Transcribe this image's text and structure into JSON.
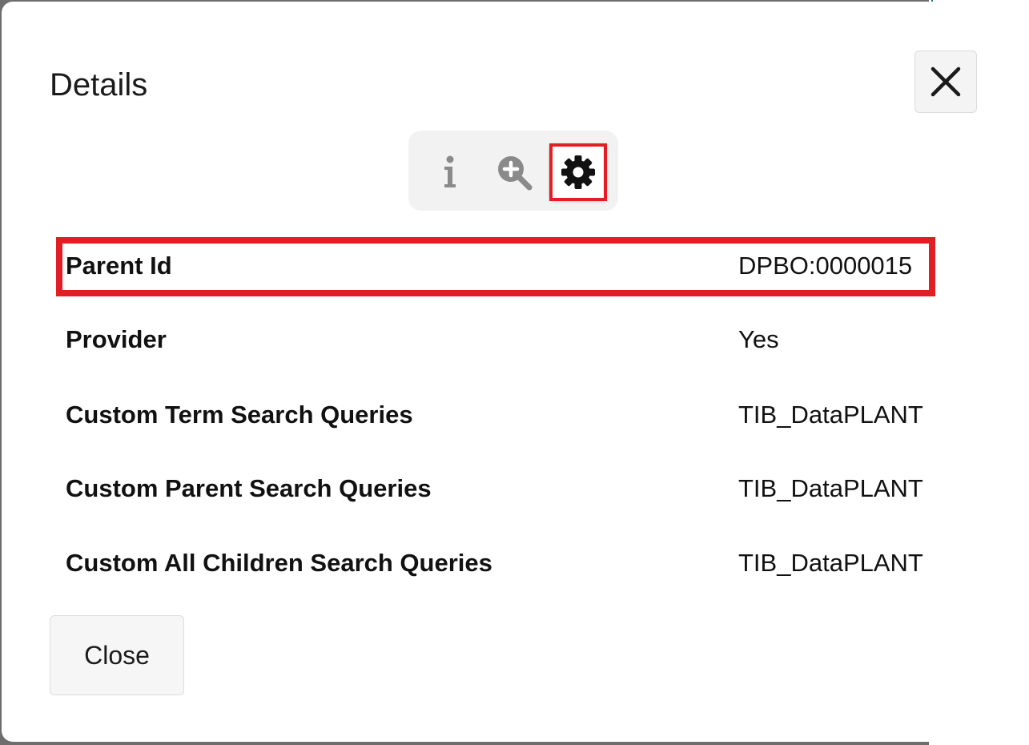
{
  "dialog": {
    "title": "Details",
    "close_label": "Close"
  },
  "tabs": [
    {
      "icon": "info-icon",
      "active": false
    },
    {
      "icon": "zoom-in-icon",
      "active": false
    },
    {
      "icon": "gear-icon",
      "active": true
    }
  ],
  "rows": [
    {
      "label": "Parent Id",
      "value": "DPBO:0000015"
    },
    {
      "label": "Provider",
      "value": "Yes"
    },
    {
      "label": "Custom Term Search Queries",
      "value": "TIB_DataPLANT"
    },
    {
      "label": "Custom Parent Search Queries",
      "value": "TIB_DataPLANT"
    },
    {
      "label": "Custom All Children Search Queries",
      "value": "TIB_DataPLANT"
    }
  ],
  "colors": {
    "highlight": "#e21d23",
    "backdrop_accent": "#2b7a5a"
  }
}
